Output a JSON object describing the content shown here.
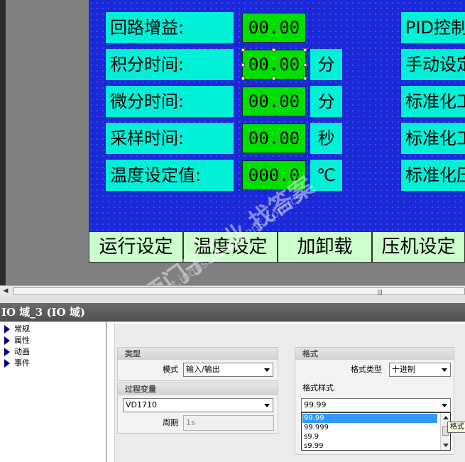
{
  "hmi": {
    "rows": [
      {
        "label": "回路增益:",
        "value": "00.00",
        "unit": "",
        "right_label": "PID控制"
      },
      {
        "label": "积分时间:",
        "value": "00.00",
        "unit": "分",
        "right_label": "手动设定"
      },
      {
        "label": "微分时间:",
        "value": "00.00",
        "unit": "分",
        "right_label": "标准化工"
      },
      {
        "label": "采样时间:",
        "value": "00.00",
        "unit": "秒",
        "right_label": "标准化工"
      },
      {
        "label": "温度设定值:",
        "value": "000.0",
        "unit": "℃",
        "right_label": "标准化压"
      }
    ],
    "buttons": [
      "运行设定",
      "温度设定",
      "加卸载",
      "压机设定"
    ]
  },
  "watermark": {
    "large": "西门子工业 找答案",
    "small": "support.industry.siemens.com/cs"
  },
  "properties": {
    "title": "IO 域_3 (IO 域)",
    "tree": [
      "常规",
      "属性",
      "动画",
      "事件"
    ],
    "type_group": {
      "title": "类型",
      "mode_label": "模式",
      "mode_value": "输入/输出"
    },
    "process_group": {
      "title": "过程变量",
      "tag_value": "VD1710",
      "cycle_label": "周期",
      "cycle_value": "1s"
    },
    "format_group": {
      "title": "格式",
      "format_type_label": "格式类型",
      "format_type_value": "十进制",
      "format_pattern_label": "格式样式",
      "format_pattern_value": "99.99",
      "options": [
        "99.99",
        "99.999",
        "s9.9",
        "s9.99"
      ],
      "tooltip": "格式"
    }
  },
  "colors": {
    "hmi_background": "#1a28d8",
    "label_cyan": "#00f0d8",
    "io_green": "#00e000",
    "button_green": "#ccffcc",
    "selection_blue": "#3399ff"
  }
}
